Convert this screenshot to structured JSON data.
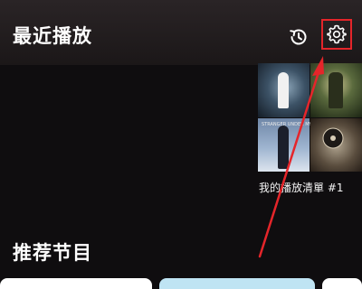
{
  "recent": {
    "title": "最近播放",
    "history_icon": "history-clock-icon",
    "settings_icon": "gear-icon"
  },
  "playlist": {
    "name": "我的播放清單 #1",
    "cover_texts": [
      "STRANGER UNDER MY SKIN"
    ]
  },
  "recommended": {
    "title": "推荐节目"
  },
  "colors": {
    "highlight_box": "#e5252a",
    "arrow": "#e5252a",
    "background": "#0f0d0f"
  }
}
